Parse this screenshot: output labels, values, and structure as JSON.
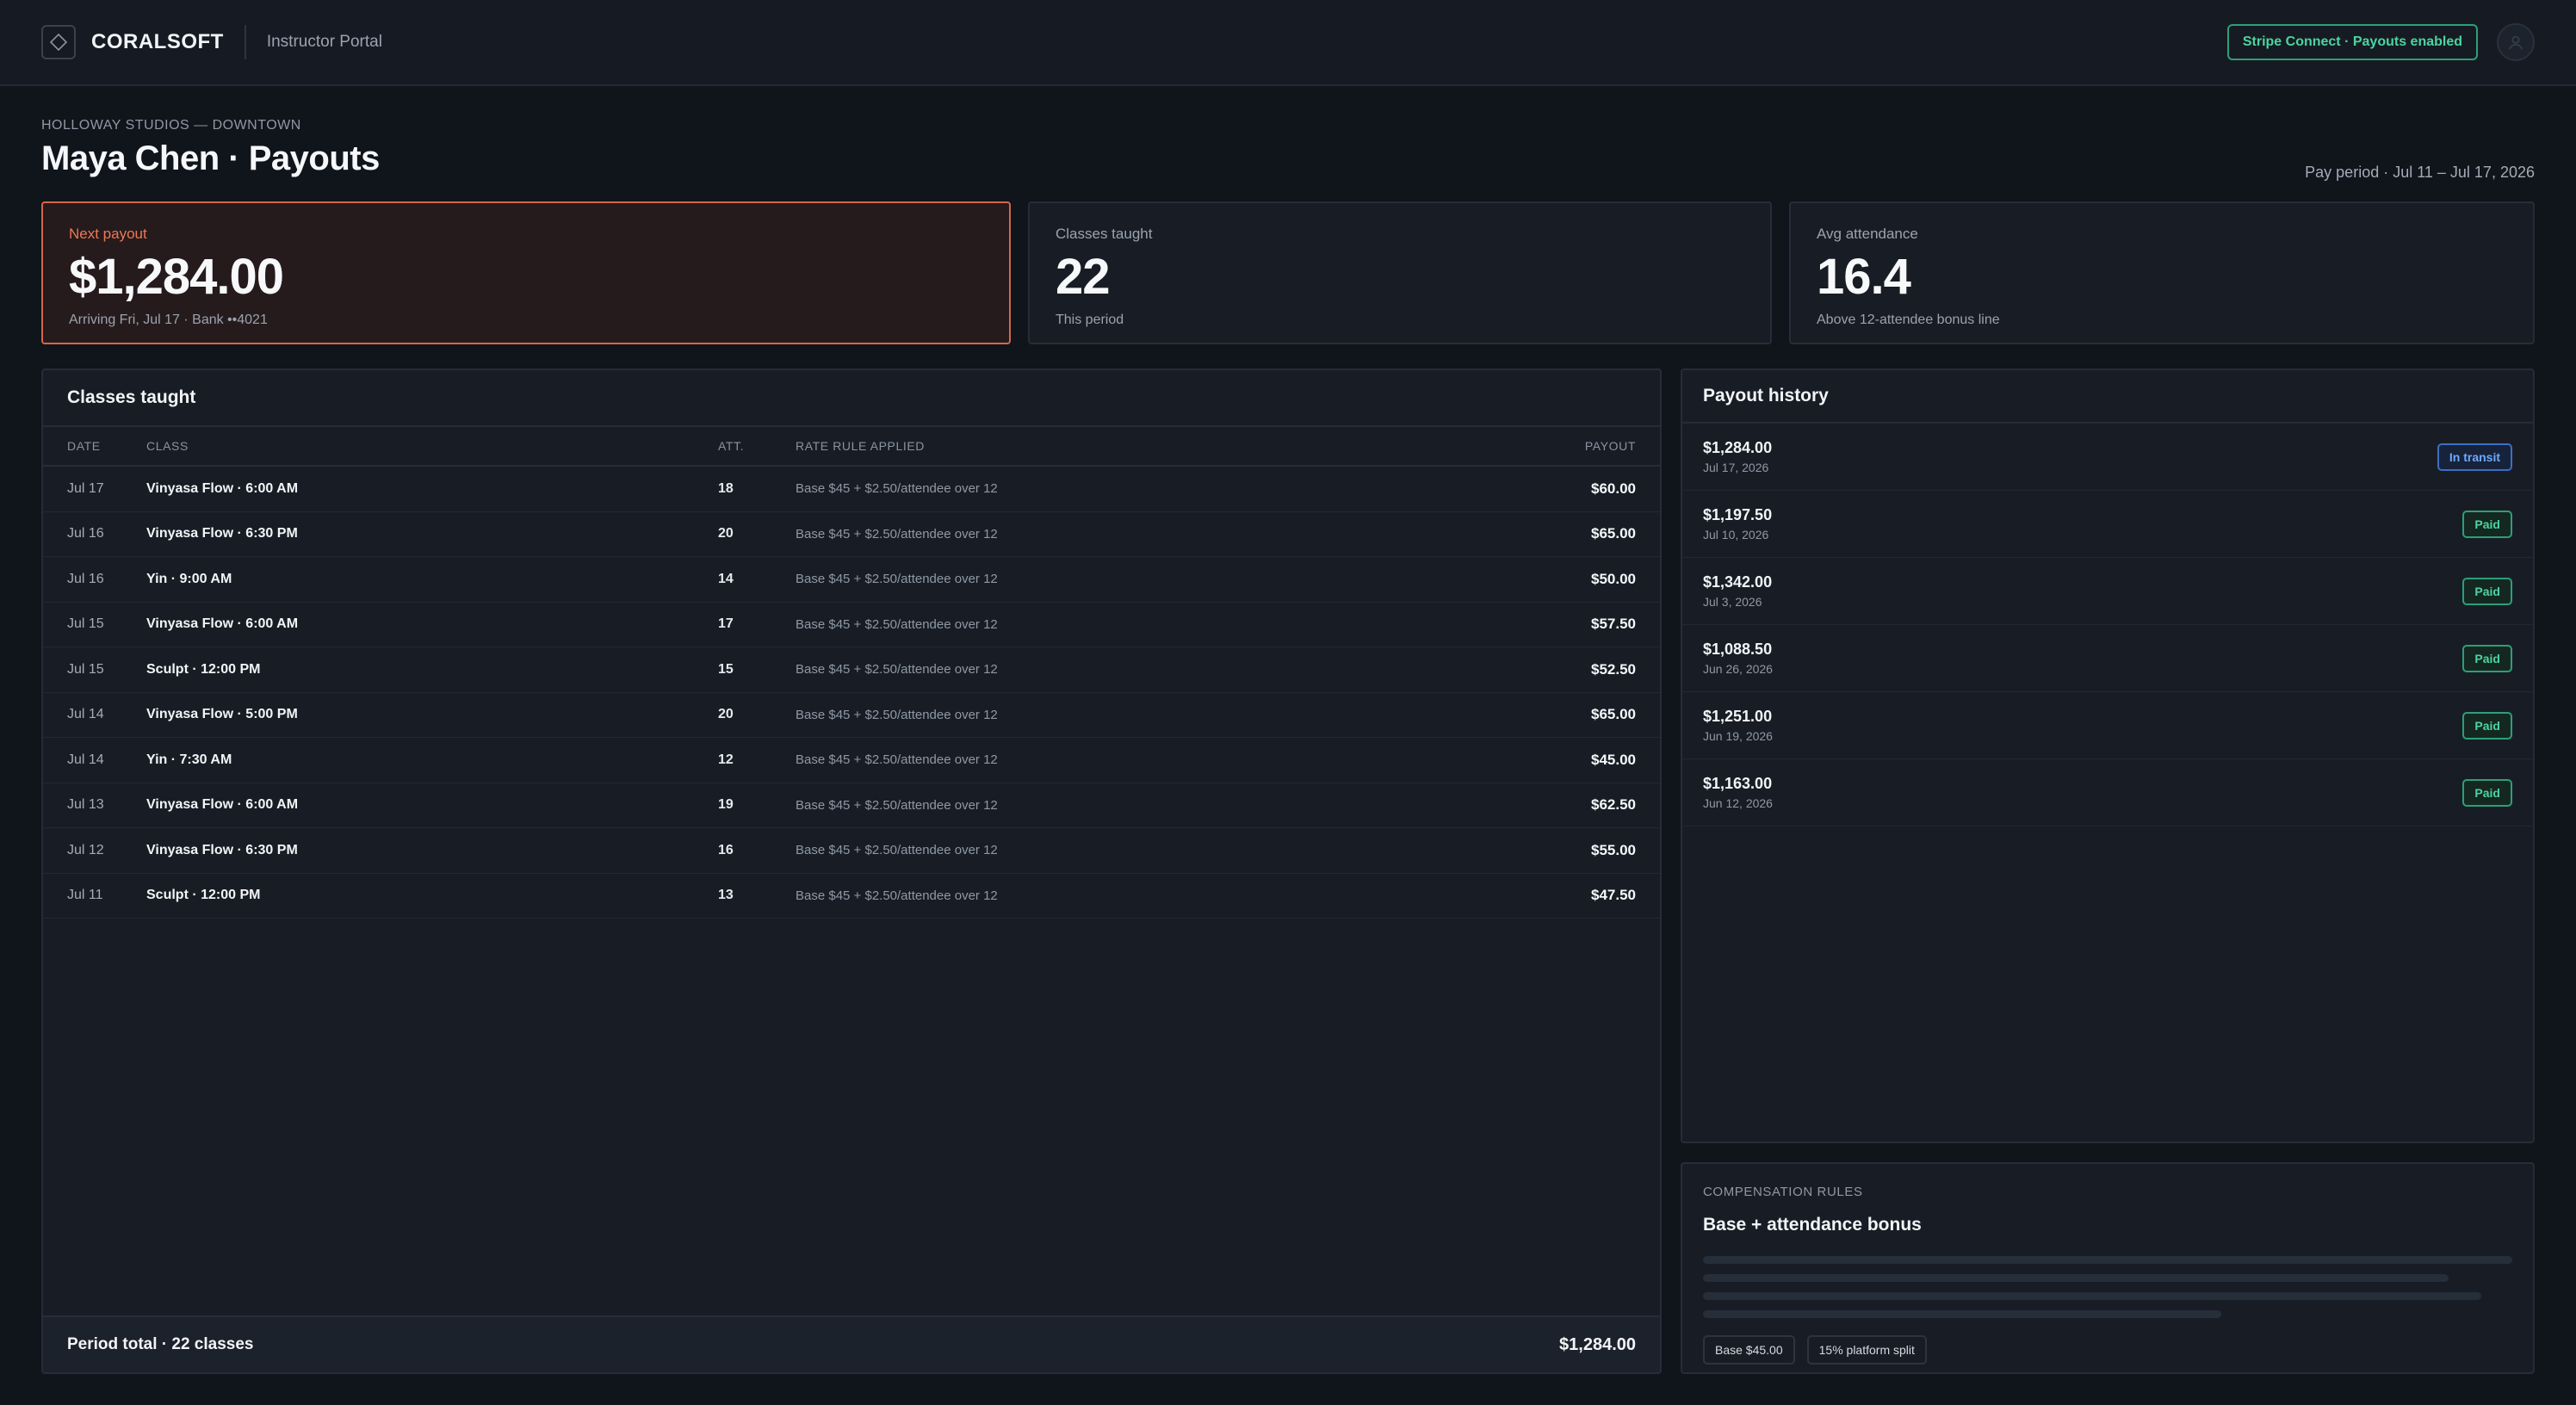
{
  "header": {
    "brand": "CORALSOFT",
    "portal": "Instructor Portal",
    "stripe_badge": "Stripe Connect · Payouts enabled"
  },
  "page": {
    "studio": "HOLLOWAY STUDIOS — DOWNTOWN",
    "title": "Maya Chen · Payouts",
    "pay_period": "Pay period · Jul 11 – Jul 17, 2026"
  },
  "stats": {
    "next_payout": {
      "label": "Next payout",
      "value": "$1,284.00",
      "sub": "Arriving Fri, Jul 17 · Bank ••4021"
    },
    "classes_taught": {
      "label": "Classes taught",
      "value": "22",
      "sub": "This period"
    },
    "avg_attendance": {
      "label": "Avg attendance",
      "value": "16.4",
      "sub": "Above 12-attendee bonus line"
    }
  },
  "classes": {
    "title": "Classes taught",
    "columns": {
      "date": "DATE",
      "class": "CLASS",
      "att": "ATT.",
      "rule": "RATE RULE APPLIED",
      "payout": "PAYOUT"
    },
    "rows": [
      {
        "date": "Jul 17",
        "class": "Vinyasa Flow · 6:00 AM",
        "att": "18",
        "rule": "Base $45 + $2.50/attendee over 12",
        "payout": "$60.00"
      },
      {
        "date": "Jul 16",
        "class": "Vinyasa Flow · 6:30 PM",
        "att": "20",
        "rule": "Base $45 + $2.50/attendee over 12",
        "payout": "$65.00"
      },
      {
        "date": "Jul 16",
        "class": "Yin · 9:00 AM",
        "att": "14",
        "rule": "Base $45 + $2.50/attendee over 12",
        "payout": "$50.00"
      },
      {
        "date": "Jul 15",
        "class": "Vinyasa Flow · 6:00 AM",
        "att": "17",
        "rule": "Base $45 + $2.50/attendee over 12",
        "payout": "$57.50"
      },
      {
        "date": "Jul 15",
        "class": "Sculpt · 12:00 PM",
        "att": "15",
        "rule": "Base $45 + $2.50/attendee over 12",
        "payout": "$52.50"
      },
      {
        "date": "Jul 14",
        "class": "Vinyasa Flow · 5:00 PM",
        "att": "20",
        "rule": "Base $45 + $2.50/attendee over 12",
        "payout": "$65.00"
      },
      {
        "date": "Jul 14",
        "class": "Yin · 7:30 AM",
        "att": "12",
        "rule": "Base $45 + $2.50/attendee over 12",
        "payout": "$45.00"
      },
      {
        "date": "Jul 13",
        "class": "Vinyasa Flow · 6:00 AM",
        "att": "19",
        "rule": "Base $45 + $2.50/attendee over 12",
        "payout": "$62.50"
      },
      {
        "date": "Jul 12",
        "class": "Vinyasa Flow · 6:30 PM",
        "att": "16",
        "rule": "Base $45 + $2.50/attendee over 12",
        "payout": "$55.00"
      },
      {
        "date": "Jul 11",
        "class": "Sculpt · 12:00 PM",
        "att": "13",
        "rule": "Base $45 + $2.50/attendee over 12",
        "payout": "$47.50"
      }
    ],
    "total_label": "Period total · 22 classes",
    "total_amount": "$1,284.00"
  },
  "history": {
    "title": "Payout history",
    "items": [
      {
        "amount": "$1,284.00",
        "date": "Jul 17, 2026",
        "status": "In transit"
      },
      {
        "amount": "$1,197.50",
        "date": "Jul 10, 2026",
        "status": "Paid"
      },
      {
        "amount": "$1,342.00",
        "date": "Jul 3, 2026",
        "status": "Paid"
      },
      {
        "amount": "$1,088.50",
        "date": "Jun 26, 2026",
        "status": "Paid"
      },
      {
        "amount": "$1,251.00",
        "date": "Jun 19, 2026",
        "status": "Paid"
      },
      {
        "amount": "$1,163.00",
        "date": "Jun 12, 2026",
        "status": "Paid"
      }
    ]
  },
  "compensation": {
    "eyebrow": "COMPENSATION RULES",
    "title": "Base + attendance bonus",
    "chips": [
      "Base $45.00",
      "15% platform split"
    ]
  },
  "colors": {
    "accent": "#d3674b",
    "paid": "#4cd4a0",
    "transit": "#6ea8ff",
    "background": "#10141b"
  }
}
